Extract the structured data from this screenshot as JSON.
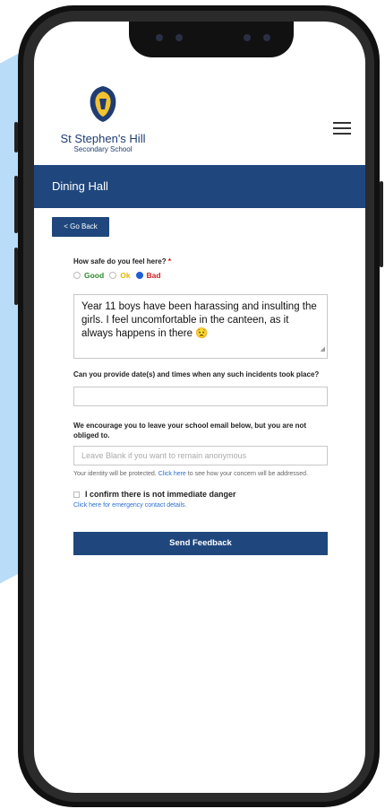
{
  "header": {
    "school_name": "St Stephen's Hill",
    "school_subtitle": "Secondary School"
  },
  "page": {
    "title": "Dining Hall",
    "back_label": "< Go Back"
  },
  "form": {
    "safety_question": "How safe do you feel here?",
    "required_mark": "*",
    "options": [
      "Good",
      "Ok",
      "Bad"
    ],
    "selected_option": "Bad",
    "option_colors": {
      "Good": "#2e8b2e",
      "Ok": "#e6b800",
      "Bad": "#d21f1f"
    },
    "message": "Year 11 boys have been harassing and insulting the girls. I feel uncomfortable in the canteen, as it always happens in there 😟",
    "dates_question": "Can you provide date(s) and times when any such incidents took place?",
    "dates_value": "",
    "email_question": "We encourage you to leave your school email below, but you are not obliged to.",
    "email_placeholder": "Leave Blank if you want to remain anonymous",
    "identity_note_before": "Your identity will be protected.",
    "identity_link": "Click here",
    "identity_note_after": "to see how your concern will be addressed.",
    "confirm_label": "I confirm there is not immediate danger",
    "emergency_link": "Click here for emergency contact details.",
    "submit_label": "Send Feedback"
  },
  "colors": {
    "brand": "#1f477d",
    "accent_bg": "#b9dcf8"
  }
}
